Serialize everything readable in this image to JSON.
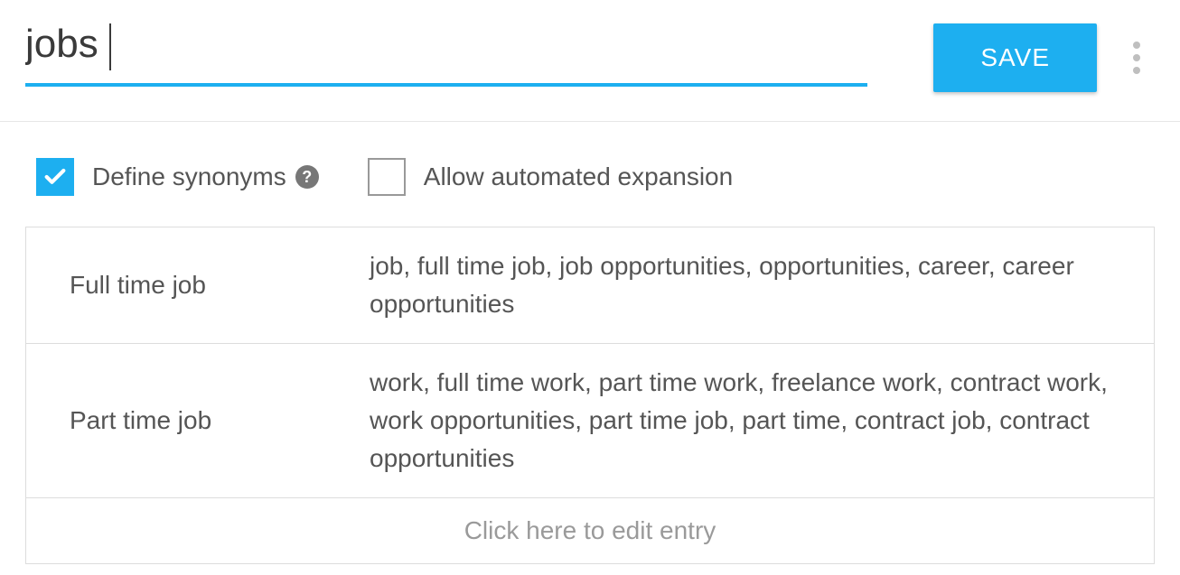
{
  "header": {
    "title": "jobs",
    "save_label": "SAVE"
  },
  "options": {
    "define_synonyms": {
      "label": "Define synonyms",
      "checked": true
    },
    "allow_expansion": {
      "label": "Allow automated expansion",
      "checked": false
    }
  },
  "entries": [
    {
      "name": "Full time job",
      "synonyms": "job, full time job, job opportunities, opportunities, career, career opportunities"
    },
    {
      "name": "Part time job",
      "synonyms": "work, full time work, part time work, freelance work, contract work, work opportunities, part time job, part time, contract job, contract opportunities"
    }
  ],
  "placeholder": "Click here to edit entry"
}
